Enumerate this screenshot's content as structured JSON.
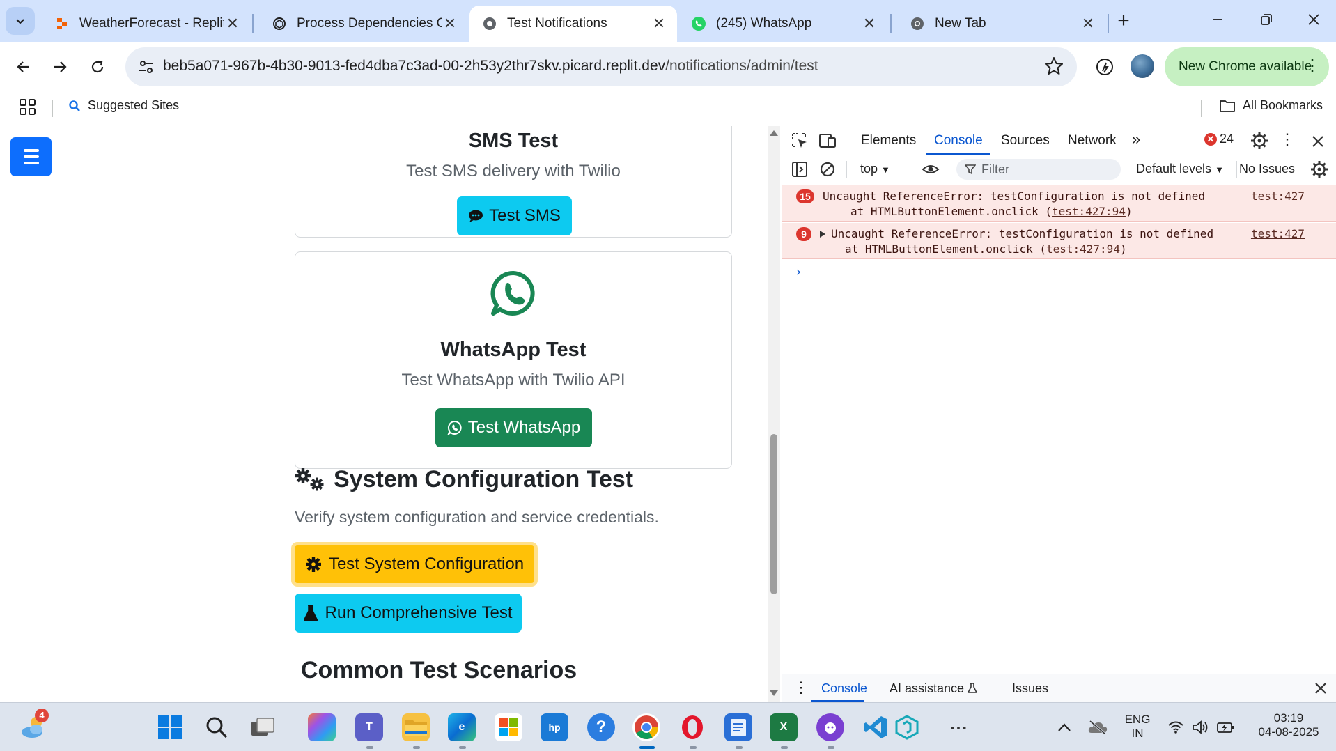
{
  "browser": {
    "tabs": [
      {
        "title": "WeatherForecast - Replit",
        "icon": "replit-icon",
        "active": false
      },
      {
        "title": "Process Dependencies O",
        "icon": "chatgpt-icon",
        "active": false
      },
      {
        "title": "Test Notifications",
        "icon": "globe-icon",
        "active": true
      },
      {
        "title": "(245) WhatsApp",
        "icon": "whatsapp-icon",
        "active": false
      },
      {
        "title": "New Tab",
        "icon": "chrome-icon",
        "active": false
      }
    ],
    "url_host": "beb5a071-967b-4b30-9013-fed4dba7c3ad-00-2h53y2thr7skv.picard.replit.dev",
    "url_path": "/notifications/admin/test",
    "update_label": "New Chrome available",
    "bookmarks": {
      "suggested": "Suggested Sites",
      "all": "All Bookmarks"
    }
  },
  "page": {
    "sms_card": {
      "title": "SMS Test",
      "text": "Test SMS delivery with Twilio",
      "button": "Test SMS"
    },
    "whatsapp_card": {
      "title": "WhatsApp Test",
      "text": "Test WhatsApp with Twilio API",
      "button": "Test WhatsApp"
    },
    "system_section": {
      "title": "System Configuration Test",
      "description": "Verify system configuration and service credentials.",
      "button_config": "Test System Configuration",
      "button_comprehensive": "Run Comprehensive Test"
    },
    "common_title": "Common Test Scenarios"
  },
  "devtools": {
    "tabs": [
      "Elements",
      "Console",
      "Sources",
      "Network"
    ],
    "active_tab": "Console",
    "error_count": "24",
    "context": "top",
    "filter_placeholder": "Filter",
    "levels": "Default levels",
    "issues": "No Issues",
    "messages": [
      {
        "count": "15",
        "line1": "Uncaught ReferenceError: testConfiguration is not defined",
        "line2_prefix": "at HTMLButtonElement.onclick (",
        "line2_link": "test:427:94",
        "line2_suffix": ")",
        "source": "test:427"
      },
      {
        "count": "9",
        "line1": "Uncaught ReferenceError: testConfiguration is not defined",
        "line2_prefix": "at HTMLButtonElement.onclick (",
        "line2_link": "test:427:94",
        "line2_suffix": ")",
        "source": "test:427"
      }
    ],
    "prompt": "›",
    "drawer_tabs": [
      "Console",
      "AI assistance",
      "Issues"
    ]
  },
  "taskbar": {
    "weather_badge": "4",
    "lang_top": "ENG",
    "lang_bottom": "IN",
    "time": "03:19",
    "date": "04-08-2025"
  },
  "colors": {
    "primary": "#0d6efd",
    "info": "#0dcaf0",
    "success": "#198754",
    "warning": "#ffc107",
    "devtools_accent": "#0b57d0",
    "error": "#dc362e"
  }
}
